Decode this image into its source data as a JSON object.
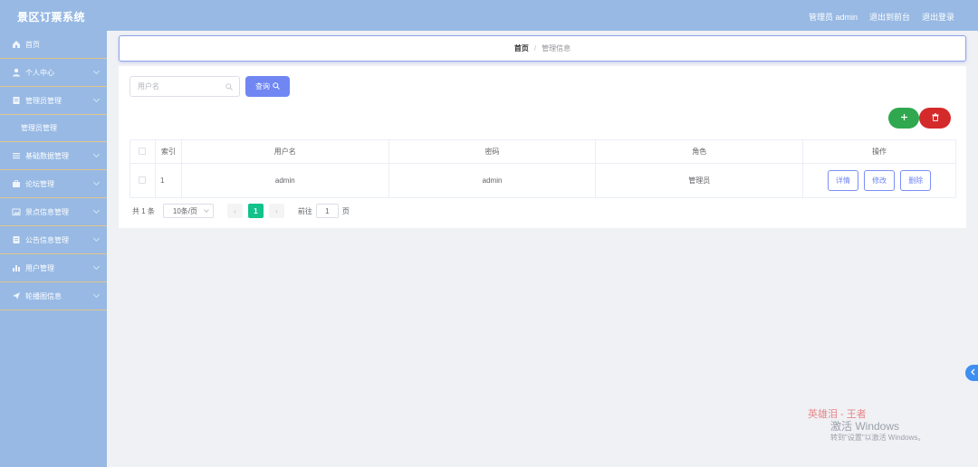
{
  "app": {
    "title": "景区订票系统",
    "admin_label": "管理员 admin",
    "back_to_front": "退出到前台",
    "logout": "退出登录"
  },
  "sidebar": {
    "items": [
      {
        "label": "首页",
        "icon": "home-icon"
      },
      {
        "label": "个人中心",
        "icon": "user-icon"
      },
      {
        "label": "管理员管理",
        "icon": "doc-icon"
      },
      {
        "label": "管理员管理",
        "icon": ""
      },
      {
        "label": "基础数据管理",
        "icon": "list-icon"
      },
      {
        "label": "论坛管理",
        "icon": "briefcase-icon"
      },
      {
        "label": "景点信息管理",
        "icon": "image-icon"
      },
      {
        "label": "公告信息管理",
        "icon": "doc-icon"
      },
      {
        "label": "用户管理",
        "icon": "bar-chart-icon"
      },
      {
        "label": "轮播图信息",
        "icon": "send-icon"
      }
    ]
  },
  "breadcrumb": {
    "home": "首页",
    "separator": "/",
    "current": "管理信息"
  },
  "search": {
    "placeholder": "用户名",
    "query_label": "查询"
  },
  "table": {
    "headers": [
      "",
      "索引",
      "用户名",
      "密码",
      "角色",
      "操作"
    ],
    "rows": [
      {
        "index": "1",
        "username": "admin",
        "password": "admin",
        "role": "管理员"
      }
    ],
    "actions": {
      "detail": "详情",
      "edit": "修改",
      "delete": "删除"
    }
  },
  "pagination": {
    "total": "共 1 条",
    "page_size": "10条/页",
    "current_page": "1",
    "goto_label": "前往",
    "goto_value": "1",
    "page_unit": "页"
  },
  "watermark": {
    "line1": "英雄泪 - 王者",
    "line2": "激活 Windows",
    "line3": "转到\"设置\"以激活 Windows。"
  },
  "colors": {
    "sidebar_bg": "#97b9e4",
    "primary": "#6f86f3",
    "success": "#2fa84f",
    "danger": "#d42a2a",
    "page_active": "#13c28a"
  }
}
